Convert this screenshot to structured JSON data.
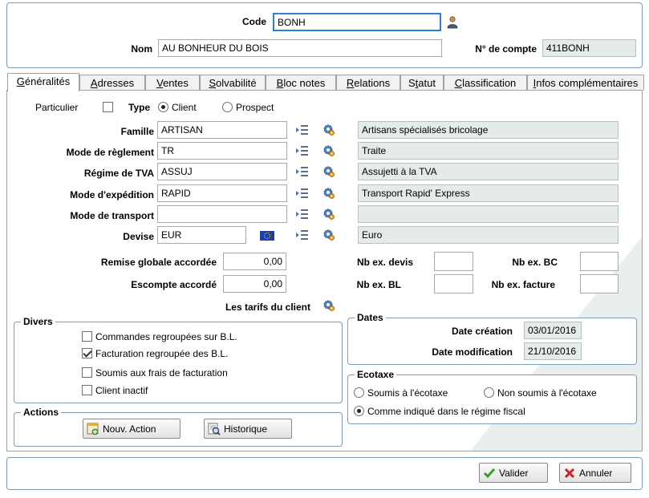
{
  "header": {
    "code_label": "Code",
    "code_value": "BONH",
    "nom_label": "Nom",
    "nom_value": "AU BONHEUR DU BOIS",
    "compte_label": "N° de compte",
    "compte_value": "411BONH"
  },
  "tabs": [
    {
      "pre": "",
      "u": "G",
      "post": "énéralités"
    },
    {
      "pre": "",
      "u": "A",
      "post": "dresses"
    },
    {
      "pre": "",
      "u": "V",
      "post": "entes"
    },
    {
      "pre": "",
      "u": "S",
      "post": "olvabilité"
    },
    {
      "pre": "",
      "u": "B",
      "post": "loc notes"
    },
    {
      "pre": "",
      "u": "R",
      "post": "elations"
    },
    {
      "pre": "S",
      "u": "t",
      "post": "atut"
    },
    {
      "pre": "",
      "u": "C",
      "post": "lassification"
    },
    {
      "pre": "",
      "u": "I",
      "post": "nfos complémentaires"
    }
  ],
  "general": {
    "particulier_label": "Particulier",
    "particulier_checked": false,
    "type_label": "Type",
    "type_client": "Client",
    "type_prospect": "Prospect",
    "type_selected": "Client",
    "fields": [
      {
        "label": "Famille",
        "value": "ARTISAN",
        "desc": "Artisans spécialisés bricolage"
      },
      {
        "label": "Mode de règlement",
        "value": "TR",
        "desc": "Traite"
      },
      {
        "label": "Régime de TVA",
        "value": "ASSUJ",
        "desc": "Assujetti à la TVA"
      },
      {
        "label": "Mode d'expédition",
        "value": "RAPID",
        "desc": "Transport Rapid' Express"
      },
      {
        "label": "Mode de transport",
        "value": "",
        "desc": ""
      },
      {
        "label": "Devise",
        "value": "EUR",
        "desc": "Euro"
      }
    ],
    "remise_label": "Remise globale accordée",
    "remise_value": "0,00",
    "escompte_label": "Escompte accordé",
    "escompte_value": "0,00",
    "tarifs_label": "Les tarifs du client",
    "nb_devis_label": "Nb ex. devis",
    "nb_devis_value": "",
    "nb_bc_label": "Nb ex. BC",
    "nb_bc_value": "",
    "nb_bl_label": "Nb ex. BL",
    "nb_bl_value": "",
    "nb_facture_label": "Nb ex. facture",
    "nb_facture_value": ""
  },
  "divers": {
    "title": "Divers",
    "items": [
      {
        "label": "Commandes regroupées sur B.L.",
        "checked": false
      },
      {
        "label": "Facturation regroupée des B.L.",
        "checked": true
      },
      {
        "label": "Soumis aux frais de facturation",
        "checked": false
      },
      {
        "label": "Client inactif",
        "checked": false
      }
    ]
  },
  "actions": {
    "title": "Actions",
    "new_action": "Nouv. Action",
    "historique": "Historique"
  },
  "dates": {
    "title": "Dates",
    "creation_label": "Date création",
    "creation_value": "03/01/2016",
    "modif_label": "Date modification",
    "modif_value": "21/10/2016"
  },
  "ecotaxe": {
    "title": "Ecotaxe",
    "opt1": "Soumis à l'écotaxe",
    "opt2": "Non soumis à l'écotaxe",
    "opt3": "Comme indiqué dans le régime fiscal",
    "selected": "opt3"
  },
  "footer": {
    "valider": "Valider",
    "annuler": "Annuler"
  },
  "colors": {
    "accent": "#2f7fd8",
    "readonly": "#e4ebe9",
    "border": "#7f9db9"
  }
}
